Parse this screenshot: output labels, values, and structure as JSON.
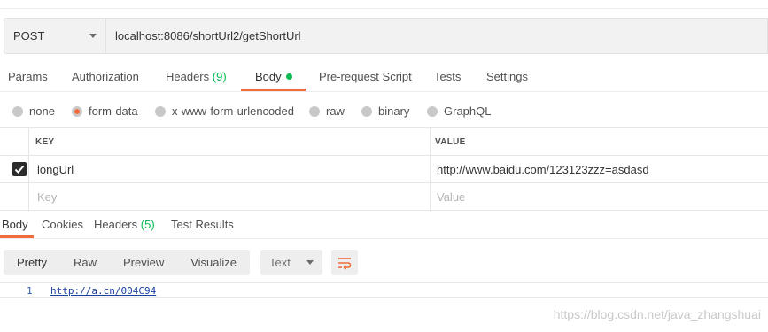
{
  "request": {
    "method": "POST",
    "url": "localhost:8086/shortUrl2/getShortUrl"
  },
  "request_tabs": {
    "params": "Params",
    "authorization": "Authorization",
    "headers": "Headers",
    "headers_count": "(9)",
    "body": "Body",
    "prerequest": "Pre-request Script",
    "tests": "Tests",
    "settings": "Settings"
  },
  "body_types": {
    "none": "none",
    "form_data": "form-data",
    "urlencoded": "x-www-form-urlencoded",
    "raw": "raw",
    "binary": "binary",
    "graphql": "GraphQL",
    "selected": "form-data"
  },
  "params_table": {
    "key_header": "KEY",
    "value_header": "VALUE",
    "rows": [
      {
        "checked": true,
        "key": "longUrl",
        "value": "http://www.baidu.com/123123zzz=asdasd"
      }
    ],
    "key_placeholder": "Key",
    "value_placeholder": "Value"
  },
  "response_tabs": {
    "body": "Body",
    "cookies": "Cookies",
    "headers": "Headers",
    "headers_count": "(5)",
    "test_results": "Test Results"
  },
  "response_view": {
    "pretty": "Pretty",
    "raw": "Raw",
    "preview": "Preview",
    "visualize": "Visualize",
    "format": "Text"
  },
  "response_body": {
    "line_number": "1",
    "content": "http://a.cn/004C94"
  },
  "watermark": "https://blog.csdn.net/java_zhangshuai",
  "colors": {
    "accent": "#f26b3a",
    "count_green": "#0cbb52",
    "link_blue": "#1a40a0"
  }
}
